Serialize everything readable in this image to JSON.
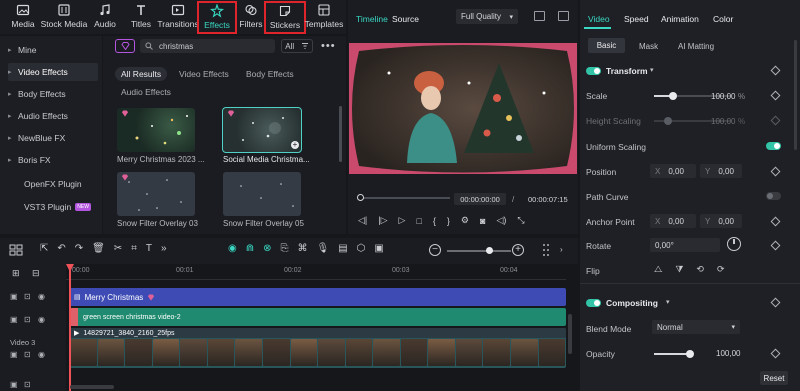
{
  "toolbar": {
    "items": [
      {
        "label": "Media"
      },
      {
        "label": "Stock Media"
      },
      {
        "label": "Audio"
      },
      {
        "label": "Titles"
      },
      {
        "label": "Transitions"
      },
      {
        "label": "Effects"
      },
      {
        "label": "Filters"
      },
      {
        "label": "Stickers"
      },
      {
        "label": "Templates"
      }
    ]
  },
  "left_nav": {
    "items": [
      {
        "label": "Mine"
      },
      {
        "label": "Video Effects"
      },
      {
        "label": "Body Effects"
      },
      {
        "label": "Audio Effects"
      },
      {
        "label": "NewBlue FX"
      },
      {
        "label": "Boris FX"
      },
      {
        "label": "OpenFX Plugin"
      },
      {
        "label": "VST3 Plugin",
        "badge": "NEW"
      }
    ]
  },
  "effects": {
    "search_value": "christmas",
    "filter_label": "All",
    "tabs": [
      "All Results",
      "Video Effects",
      "Body Effects",
      "Audio Effects"
    ],
    "thumbnails": [
      {
        "label": "Merry Christmas 2023 ..."
      },
      {
        "label": "Social Media Christma..."
      },
      {
        "label": "Snow Filter Overlay 03"
      },
      {
        "label": "Snow Filter Overlay 05"
      }
    ]
  },
  "preview": {
    "tab_timeline": "Timeline",
    "tab_source": "Source",
    "quality": "Full Quality",
    "current_time": "00:00:00:00",
    "separator": "/",
    "total_time": "00:00:07:15",
    "progress_fraction": 0.0
  },
  "props": {
    "tabs": [
      "Video",
      "Speed",
      "Animation",
      "Color"
    ],
    "subtabs": [
      "Basic",
      "Mask",
      "AI Matting"
    ],
    "transform_label": "Transform",
    "scale_label": "Scale",
    "scale_value": "100,00",
    "scale_unit": "%",
    "scale_fraction": 0.25,
    "height_scaling_label": "Height Scaling",
    "height_scaling_value": "100,00",
    "height_scaling_unit": "%",
    "uniform_scaling_label": "Uniform Scaling",
    "position_label": "Position",
    "position_x_prefix": "X",
    "position_x": "0,00",
    "position_y_prefix": "Y",
    "position_y": "0,00",
    "path_curve_label": "Path Curve",
    "anchor_label": "Anchor Point",
    "anchor_x_prefix": "X",
    "anchor_x": "0,00",
    "anchor_y_prefix": "Y",
    "anchor_y": "0,00",
    "rotate_label": "Rotate",
    "rotate_value": "0,00°",
    "flip_label": "Flip",
    "compositing_label": "Compositing",
    "blend_mode_label": "Blend Mode",
    "blend_mode_value": "Normal",
    "opacity_label": "Opacity",
    "opacity_value": "100,00",
    "opacity_fraction": 1.0,
    "reset_label": "Reset"
  },
  "timeline": {
    "ruler": [
      "00:00",
      "00:01",
      "00:02",
      "00:03",
      "00:04"
    ],
    "track3_label": "Video 3",
    "clips": [
      {
        "label": "Merry Christmas"
      },
      {
        "label": "green screen christmas video-2"
      },
      {
        "label": "14829721_3840_2160_25fps"
      }
    ]
  },
  "colors": {
    "accent": "#39d9c4",
    "highlight_border": "#e0242b",
    "effect_clip": "#3e4bb5",
    "video_clip": "#1f8a6f",
    "playhead": "#f0525a"
  }
}
